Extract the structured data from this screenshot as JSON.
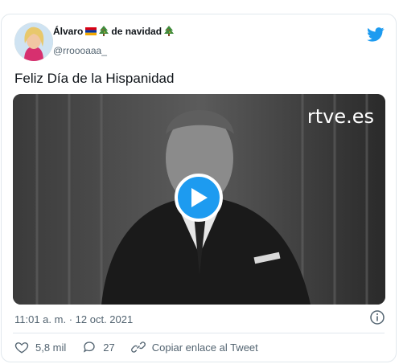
{
  "author": {
    "display_name_prefix": "Álvaro",
    "display_name_suffix": "de navidad",
    "handle": "@rroooaaa_"
  },
  "tweet": {
    "text": "Feliz Día de la Hispanidad",
    "time": "11:01 a. m.",
    "separator": " · ",
    "date": "12 oct. 2021"
  },
  "video": {
    "watermark": "rtve.es"
  },
  "actions": {
    "likes": "5,8 mil",
    "replies": "27",
    "copy_link": "Copiar enlace al Tweet"
  },
  "colors": {
    "twitter_blue": "#1d9bf0",
    "muted_text": "#536471"
  }
}
